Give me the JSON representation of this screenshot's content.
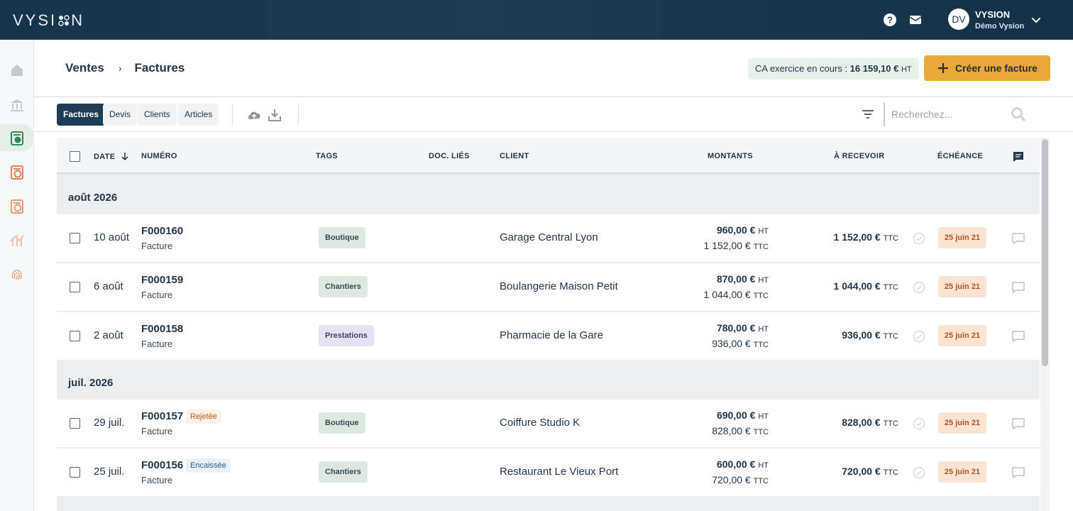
{
  "app": {
    "logo": "VYSI  N"
  },
  "user": {
    "initials": "DV",
    "name": "VYSION",
    "company": "Démo Vysion"
  },
  "breadcrumb": {
    "parent": "Ventes",
    "separator": "›",
    "current": "Factures"
  },
  "ca_badge": {
    "label": "CA exercice en cours : ",
    "value": "16 159,10 €",
    "suffix": "HT"
  },
  "create_button": {
    "label": "Créer une facture"
  },
  "tabs": [
    {
      "label": "Factures",
      "active": true
    },
    {
      "label": "Devis"
    },
    {
      "label": "Clients"
    },
    {
      "label": "Articles"
    }
  ],
  "search": {
    "placeholder": "Recherchez..."
  },
  "columns": {
    "date": "DATE",
    "numero": "NUMÉRO",
    "tags": "TAGS",
    "docs": "DOC. LIÉS",
    "client": "CLIENT",
    "montants": "MONTANTS",
    "recevoir": "À RECEVOIR",
    "echeance": "ÉCHÉANCE"
  },
  "groups": [
    {
      "title": "août 2026",
      "rows": [
        {
          "date": "10 août",
          "numero": "F000160",
          "type": "Facture",
          "status": "",
          "tag": "Boutique",
          "client": "Garage Central Lyon",
          "ht": "960,00 €",
          "ttc": "1 152,00 €",
          "recevoir": "1 152,00 €",
          "echeance": "25 juin 21"
        },
        {
          "date": "6 août",
          "numero": "F000159",
          "type": "Facture",
          "status": "",
          "tag": "Chantiers",
          "client": "Boulangerie Maison Petit",
          "ht": "870,00 €",
          "ttc": "1 044,00 €",
          "recevoir": "1 044,00 €",
          "echeance": "25 juin 21"
        },
        {
          "date": "2 août",
          "numero": "F000158",
          "type": "Facture",
          "status": "",
          "tag": "Prestations",
          "client": "Pharmacie de la Gare",
          "ht": "780,00 €",
          "ttc": "936,00 €",
          "recevoir": "936,00 €",
          "echeance": "25 juin 21"
        }
      ]
    },
    {
      "title": "juil. 2026",
      "rows": [
        {
          "date": "29 juil.",
          "numero": "F000157",
          "type": "Facture",
          "status": "Rejetée",
          "tag": "Boutique",
          "client": "Coiffure Studio K",
          "ht": "690,00 €",
          "ttc": "828,00 €",
          "recevoir": "828,00 €",
          "echeance": "25 juin 21"
        },
        {
          "date": "25 juil.",
          "numero": "F000156",
          "type": "Facture",
          "status": "Encaissée",
          "tag": "Chantiers",
          "client": "Restaurant Le Vieux Port",
          "ht": "600,00 €",
          "ttc": "720,00 €",
          "recevoir": "720,00 €",
          "echeance": "25 juin 21"
        }
      ]
    }
  ],
  "units": {
    "ht": "HT",
    "ttc": "TTC"
  },
  "colors": {
    "topbar": "#1d3d56",
    "accent": "#e8a93a",
    "active_tab": "#1d3d56",
    "due_badge": "#fbe3d1",
    "tag_green": "#dde9e0",
    "tag_purple": "#e7e1f3"
  },
  "icons": [
    "help-icon",
    "mail-icon",
    "chevron-down-icon",
    "home-icon",
    "bank-icon",
    "sales-icon",
    "purchases-icon",
    "expenses-icon",
    "reports-icon",
    "fingerprint-icon",
    "upload-cloud-icon",
    "download-icon",
    "filter-icon",
    "search-icon",
    "sort-arrow-icon",
    "comment-icon",
    "check-circle-icon"
  ]
}
